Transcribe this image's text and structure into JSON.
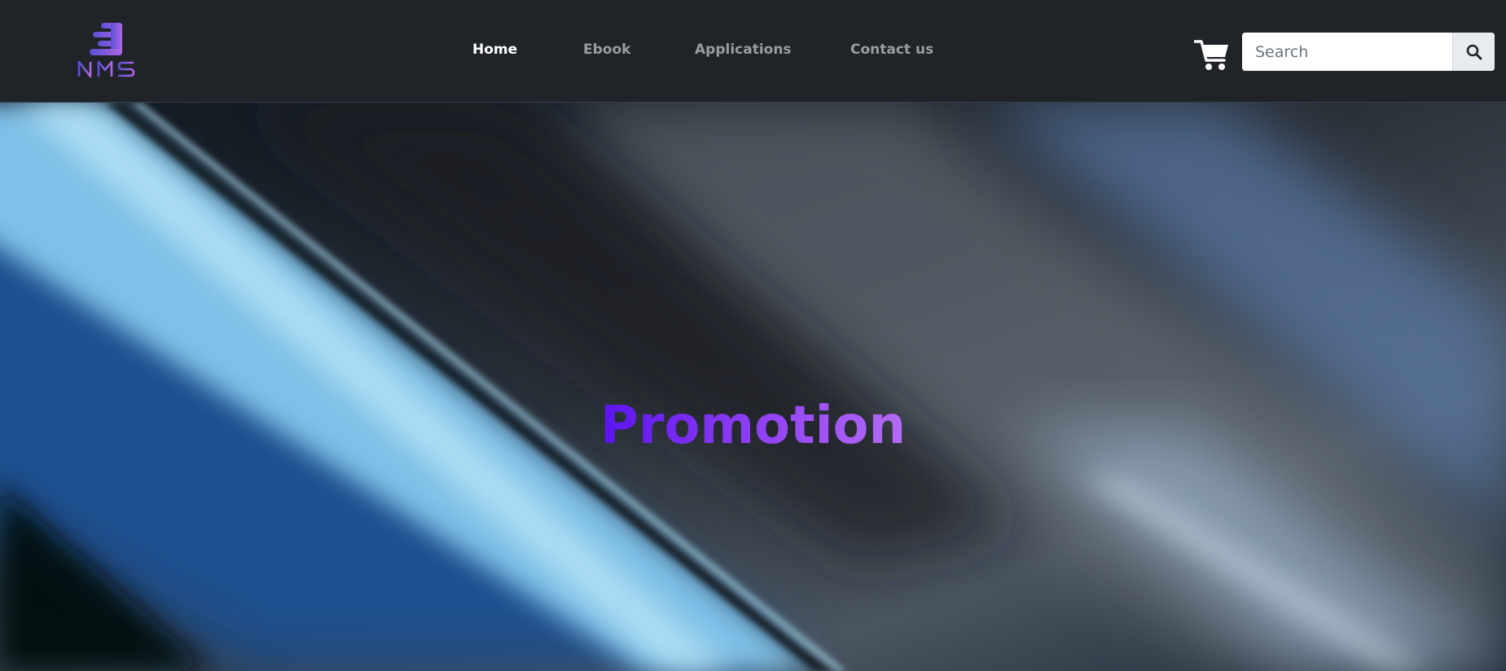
{
  "brand": {
    "logo_text": "NMS",
    "colors": {
      "logo_start": "#5a4fd6",
      "logo_end": "#b067e3"
    }
  },
  "nav": {
    "items": [
      {
        "label": "Home",
        "active": true
      },
      {
        "label": "Ebook",
        "active": false
      },
      {
        "label": "Applications",
        "active": false
      },
      {
        "label": "Contact us",
        "active": false
      }
    ]
  },
  "cart": {
    "icon": "shopping-cart-icon"
  },
  "search": {
    "placeholder": "Search",
    "value": "",
    "button_icon": "search-icon"
  },
  "hero": {
    "title": "Promotion",
    "title_colors": [
      "#5b14f0",
      "#b36cf5"
    ]
  },
  "colors": {
    "navbar_bg": "#202328",
    "nav_active": "#ffffff",
    "nav_inactive": "#9a9da2"
  }
}
